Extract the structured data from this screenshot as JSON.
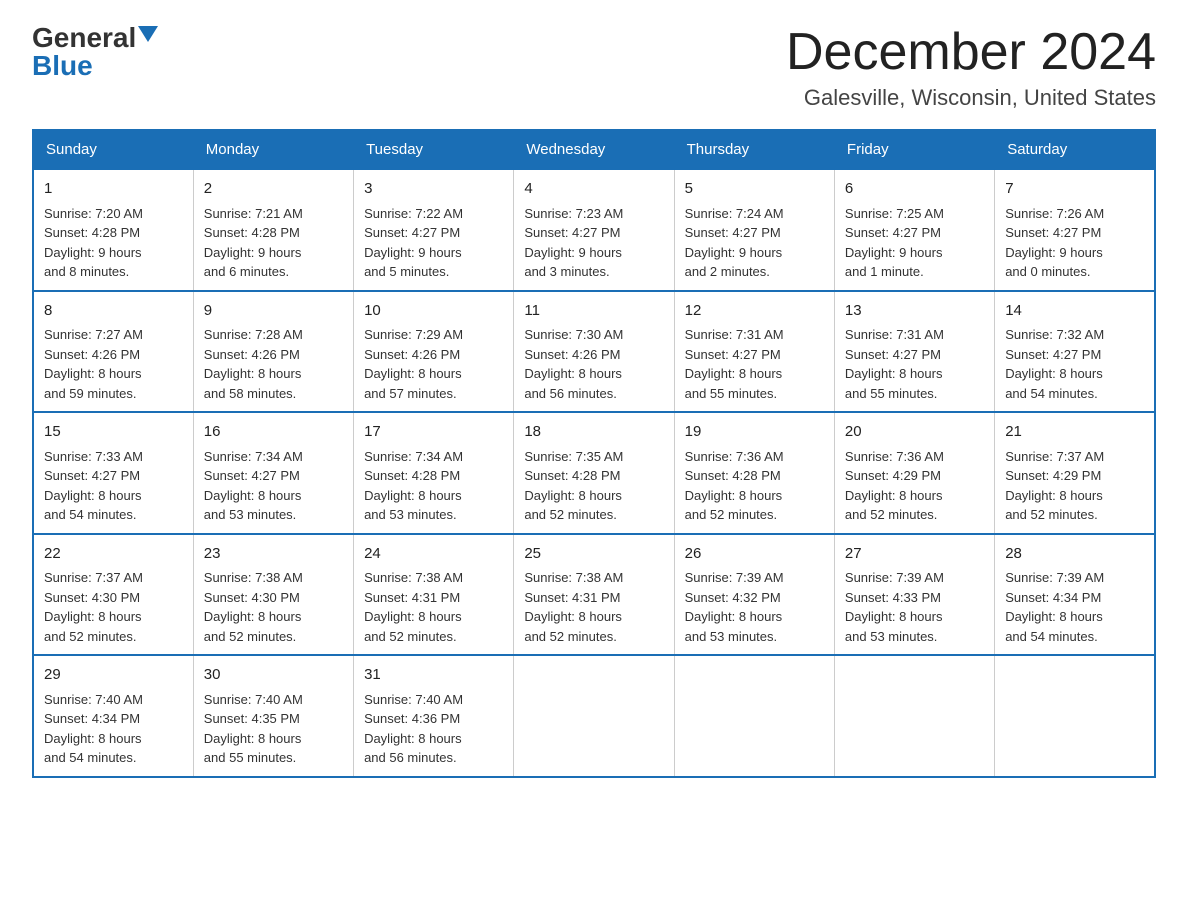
{
  "logo": {
    "general": "General",
    "blue": "Blue"
  },
  "title": "December 2024",
  "subtitle": "Galesville, Wisconsin, United States",
  "days_of_week": [
    "Sunday",
    "Monday",
    "Tuesday",
    "Wednesday",
    "Thursday",
    "Friday",
    "Saturday"
  ],
  "weeks": [
    [
      {
        "day": "1",
        "info": "Sunrise: 7:20 AM\nSunset: 4:28 PM\nDaylight: 9 hours\nand 8 minutes."
      },
      {
        "day": "2",
        "info": "Sunrise: 7:21 AM\nSunset: 4:28 PM\nDaylight: 9 hours\nand 6 minutes."
      },
      {
        "day": "3",
        "info": "Sunrise: 7:22 AM\nSunset: 4:27 PM\nDaylight: 9 hours\nand 5 minutes."
      },
      {
        "day": "4",
        "info": "Sunrise: 7:23 AM\nSunset: 4:27 PM\nDaylight: 9 hours\nand 3 minutes."
      },
      {
        "day": "5",
        "info": "Sunrise: 7:24 AM\nSunset: 4:27 PM\nDaylight: 9 hours\nand 2 minutes."
      },
      {
        "day": "6",
        "info": "Sunrise: 7:25 AM\nSunset: 4:27 PM\nDaylight: 9 hours\nand 1 minute."
      },
      {
        "day": "7",
        "info": "Sunrise: 7:26 AM\nSunset: 4:27 PM\nDaylight: 9 hours\nand 0 minutes."
      }
    ],
    [
      {
        "day": "8",
        "info": "Sunrise: 7:27 AM\nSunset: 4:26 PM\nDaylight: 8 hours\nand 59 minutes."
      },
      {
        "day": "9",
        "info": "Sunrise: 7:28 AM\nSunset: 4:26 PM\nDaylight: 8 hours\nand 58 minutes."
      },
      {
        "day": "10",
        "info": "Sunrise: 7:29 AM\nSunset: 4:26 PM\nDaylight: 8 hours\nand 57 minutes."
      },
      {
        "day": "11",
        "info": "Sunrise: 7:30 AM\nSunset: 4:26 PM\nDaylight: 8 hours\nand 56 minutes."
      },
      {
        "day": "12",
        "info": "Sunrise: 7:31 AM\nSunset: 4:27 PM\nDaylight: 8 hours\nand 55 minutes."
      },
      {
        "day": "13",
        "info": "Sunrise: 7:31 AM\nSunset: 4:27 PM\nDaylight: 8 hours\nand 55 minutes."
      },
      {
        "day": "14",
        "info": "Sunrise: 7:32 AM\nSunset: 4:27 PM\nDaylight: 8 hours\nand 54 minutes."
      }
    ],
    [
      {
        "day": "15",
        "info": "Sunrise: 7:33 AM\nSunset: 4:27 PM\nDaylight: 8 hours\nand 54 minutes."
      },
      {
        "day": "16",
        "info": "Sunrise: 7:34 AM\nSunset: 4:27 PM\nDaylight: 8 hours\nand 53 minutes."
      },
      {
        "day": "17",
        "info": "Sunrise: 7:34 AM\nSunset: 4:28 PM\nDaylight: 8 hours\nand 53 minutes."
      },
      {
        "day": "18",
        "info": "Sunrise: 7:35 AM\nSunset: 4:28 PM\nDaylight: 8 hours\nand 52 minutes."
      },
      {
        "day": "19",
        "info": "Sunrise: 7:36 AM\nSunset: 4:28 PM\nDaylight: 8 hours\nand 52 minutes."
      },
      {
        "day": "20",
        "info": "Sunrise: 7:36 AM\nSunset: 4:29 PM\nDaylight: 8 hours\nand 52 minutes."
      },
      {
        "day": "21",
        "info": "Sunrise: 7:37 AM\nSunset: 4:29 PM\nDaylight: 8 hours\nand 52 minutes."
      }
    ],
    [
      {
        "day": "22",
        "info": "Sunrise: 7:37 AM\nSunset: 4:30 PM\nDaylight: 8 hours\nand 52 minutes."
      },
      {
        "day": "23",
        "info": "Sunrise: 7:38 AM\nSunset: 4:30 PM\nDaylight: 8 hours\nand 52 minutes."
      },
      {
        "day": "24",
        "info": "Sunrise: 7:38 AM\nSunset: 4:31 PM\nDaylight: 8 hours\nand 52 minutes."
      },
      {
        "day": "25",
        "info": "Sunrise: 7:38 AM\nSunset: 4:31 PM\nDaylight: 8 hours\nand 52 minutes."
      },
      {
        "day": "26",
        "info": "Sunrise: 7:39 AM\nSunset: 4:32 PM\nDaylight: 8 hours\nand 53 minutes."
      },
      {
        "day": "27",
        "info": "Sunrise: 7:39 AM\nSunset: 4:33 PM\nDaylight: 8 hours\nand 53 minutes."
      },
      {
        "day": "28",
        "info": "Sunrise: 7:39 AM\nSunset: 4:34 PM\nDaylight: 8 hours\nand 54 minutes."
      }
    ],
    [
      {
        "day": "29",
        "info": "Sunrise: 7:40 AM\nSunset: 4:34 PM\nDaylight: 8 hours\nand 54 minutes."
      },
      {
        "day": "30",
        "info": "Sunrise: 7:40 AM\nSunset: 4:35 PM\nDaylight: 8 hours\nand 55 minutes."
      },
      {
        "day": "31",
        "info": "Sunrise: 7:40 AM\nSunset: 4:36 PM\nDaylight: 8 hours\nand 56 minutes."
      },
      {
        "day": "",
        "info": ""
      },
      {
        "day": "",
        "info": ""
      },
      {
        "day": "",
        "info": ""
      },
      {
        "day": "",
        "info": ""
      }
    ]
  ]
}
